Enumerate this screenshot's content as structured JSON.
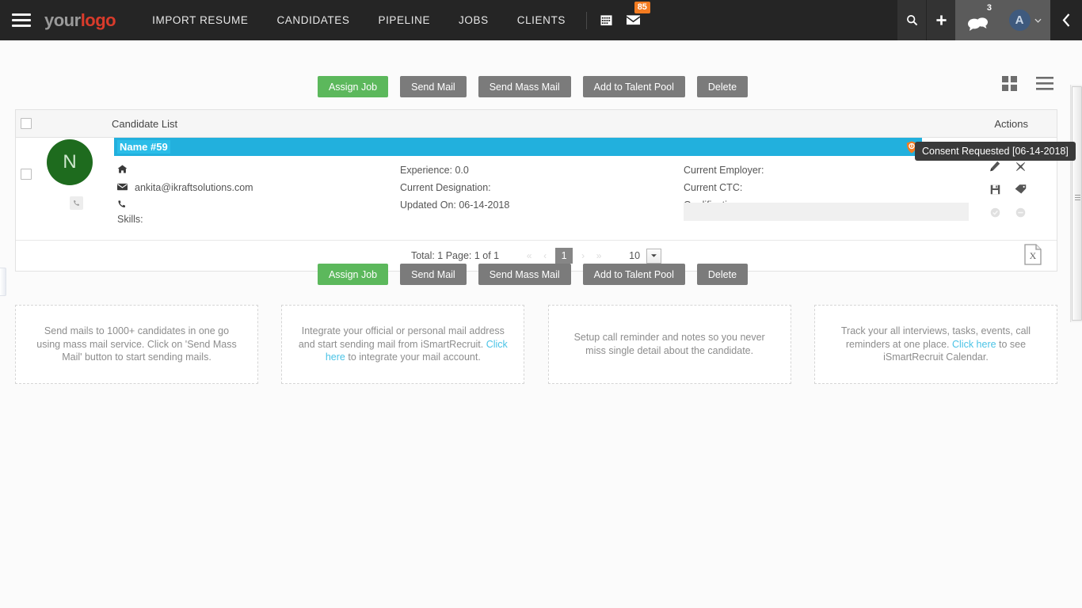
{
  "topnav": {
    "menu_icon": "hamburger-icon",
    "logo_part1": "your",
    "logo_part2": "logo",
    "links": [
      {
        "label": "IMPORT RESUME"
      },
      {
        "label": "CANDIDATES"
      },
      {
        "label": "PIPELINE"
      },
      {
        "label": "JOBS"
      },
      {
        "label": "CLIENTS"
      }
    ],
    "calendar_icon": "calendar-icon",
    "mail_icon": "mail-icon",
    "mail_badge": "85",
    "search_icon": "search-icon",
    "add_icon": "plus-icon",
    "chat_icon": "chat-icon",
    "chat_badge": "3",
    "avatar_initial": "A",
    "collapse_icon": "chevron-left-icon"
  },
  "toolbar": {
    "assign_job": "Assign Job",
    "send_mail": "Send Mail",
    "send_mass_mail": "Send Mass Mail",
    "add_to_talent_pool": "Add to Talent Pool",
    "delete": "Delete",
    "grid_view_icon": "grid-view-icon",
    "list_view_icon": "list-view-icon"
  },
  "list": {
    "title": "Candidate List",
    "actions_header": "Actions"
  },
  "candidate": {
    "avatar_initial": "N",
    "name": "Name #59",
    "consent_icon": "shield-icon",
    "consent_tooltip": "Consent Requested [06-14-2018]",
    "home_icon": "home-icon",
    "home_value": "",
    "mail_icon": "envelope-icon",
    "email": "ankita@ikraftsolutions.com",
    "phone_icon": "phone-icon",
    "phone": "",
    "skills_label": "Skills:",
    "experience": "Experience: 0.0",
    "current_designation": "Current Designation:",
    "updated_on": "Updated On: 06-14-2018",
    "current_employer": "Current Employer:",
    "current_ctc": "Current CTC:",
    "qualification": "Qualification:",
    "actions": [
      {
        "name": "edit-icon",
        "glyph": "✎",
        "enabled": true
      },
      {
        "name": "close-icon",
        "glyph": "✖",
        "enabled": true
      },
      {
        "name": "save-icon",
        "glyph": "Ὃe",
        "enabled": true
      },
      {
        "name": "tag-icon",
        "glyph": "Ἷ7",
        "enabled": true
      },
      {
        "name": "thumbs-up-icon",
        "glyph": "●",
        "enabled": false
      },
      {
        "name": "thumbs-down-icon",
        "glyph": "●",
        "enabled": false
      }
    ],
    "call_icon": "phone-square-icon"
  },
  "pagination": {
    "total_text": "Total: 1 Page: 1 of 1",
    "first_arrow": "«",
    "prev_arrow": "‹",
    "current_page": "1",
    "next_arrow": "›",
    "last_arrow": "»",
    "page_size": "10",
    "dropdown_icon": "chevron-down-icon",
    "export_icon": "excel-export-icon"
  },
  "cards": [
    {
      "text_before": "Send mails to 1000+ candidates in one go using mass mail service. Click on 'Send Mass Mail' button to start sending mails.",
      "link": "",
      "text_after": ""
    },
    {
      "text_before": "Integrate your official or personal mail address and start sending mail from iSmartRecruit. ",
      "link": "Click here",
      "text_after": " to integrate your mail account."
    },
    {
      "text_before": "Setup call reminder and notes so you never miss single detail about the candidate.",
      "link": "",
      "text_after": ""
    },
    {
      "text_before": "Track your all interviews, tasks, events, call reminders at one place. ",
      "link": "Click here",
      "text_after": " to see iSmartRecruit Calendar."
    }
  ],
  "colors": {
    "nav_bg": "#252525",
    "accent_green": "#5cb85c",
    "accent_cyan": "#22b0dd",
    "avatar_green": "#1e6b1e",
    "badge_orange": "#f47b20",
    "link_blue": "#4ac3e6"
  }
}
